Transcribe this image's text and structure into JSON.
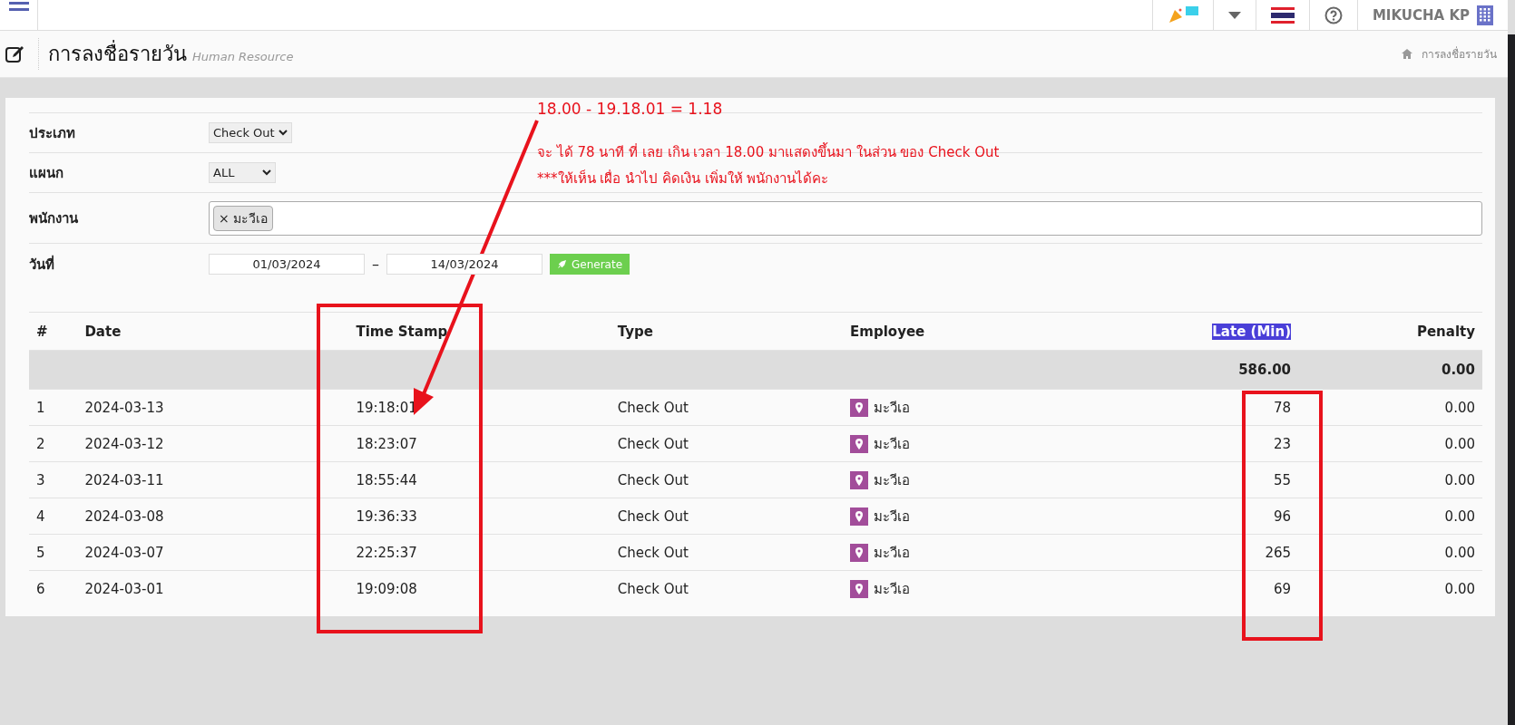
{
  "topbar": {
    "user_name": "MIKUCHA KP"
  },
  "page_header": {
    "title": "การลงชื่อรายวัน",
    "subtitle": "Human Resource",
    "breadcrumb": "การลงชื่อรายวัน"
  },
  "filters": [
    {
      "kind": "select",
      "label": "ประเภท",
      "value": "Check Out"
    },
    {
      "kind": "select",
      "label": "แผนก",
      "value": "ALL"
    },
    {
      "kind": "tags",
      "label": "พนักงาน",
      "remove_glyph": "×",
      "tags": [
        "มะวีเอ"
      ]
    },
    {
      "kind": "daterange",
      "label": "วันที่",
      "from": "01/03/2024",
      "separator": "–",
      "to": "14/03/2024",
      "button": "Generate"
    }
  ],
  "table": {
    "columns": [
      {
        "label": "#",
        "highlighted": false
      },
      {
        "label": "Date",
        "highlighted": false
      },
      {
        "label": "Time Stamp",
        "highlighted": false
      },
      {
        "label": "Type",
        "highlighted": false
      },
      {
        "label": "Employee",
        "highlighted": false
      },
      {
        "label": "Late (Min)",
        "highlighted": true
      },
      {
        "label": "Penalty",
        "highlighted": false
      }
    ],
    "total_row": {
      "late": "586.00",
      "penalty": "0.00"
    },
    "rows": [
      {
        "no": "1",
        "date": "2024-03-13",
        "time": "19:18:01",
        "type": "Check Out",
        "employee": "มะวีเอ",
        "late": "78",
        "penalty": "0.00"
      },
      {
        "no": "2",
        "date": "2024-03-12",
        "time": "18:23:07",
        "type": "Check Out",
        "employee": "มะวีเอ",
        "late": "23",
        "penalty": "0.00"
      },
      {
        "no": "3",
        "date": "2024-03-11",
        "time": "18:55:44",
        "type": "Check Out",
        "employee": "มะวีเอ",
        "late": "55",
        "penalty": "0.00"
      },
      {
        "no": "4",
        "date": "2024-03-08",
        "time": "19:36:33",
        "type": "Check Out",
        "employee": "มะวีเอ",
        "late": "96",
        "penalty": "0.00"
      },
      {
        "no": "5",
        "date": "2024-03-07",
        "time": "22:25:37",
        "type": "Check Out",
        "employee": "มะวีเอ",
        "late": "265",
        "penalty": "0.00"
      },
      {
        "no": "6",
        "date": "2024-03-01",
        "time": "19:09:08",
        "type": "Check Out",
        "employee": "มะวีเอ",
        "late": "69",
        "penalty": "0.00"
      }
    ]
  },
  "annotations": {
    "formula": "18.00 - 19.18.01   = 1.18",
    "lines": [
      "จะ ได้ 78   นาที  ที่  เลย เกิน  เวลา 18.00 มาแสดงขึ้นมา ในส่วน ของ    Check Out",
      "***ให้เห็น เผื่อ นำไป  คิดเงิน เพิ่มให้ พนักงานได้คะ"
    ]
  }
}
